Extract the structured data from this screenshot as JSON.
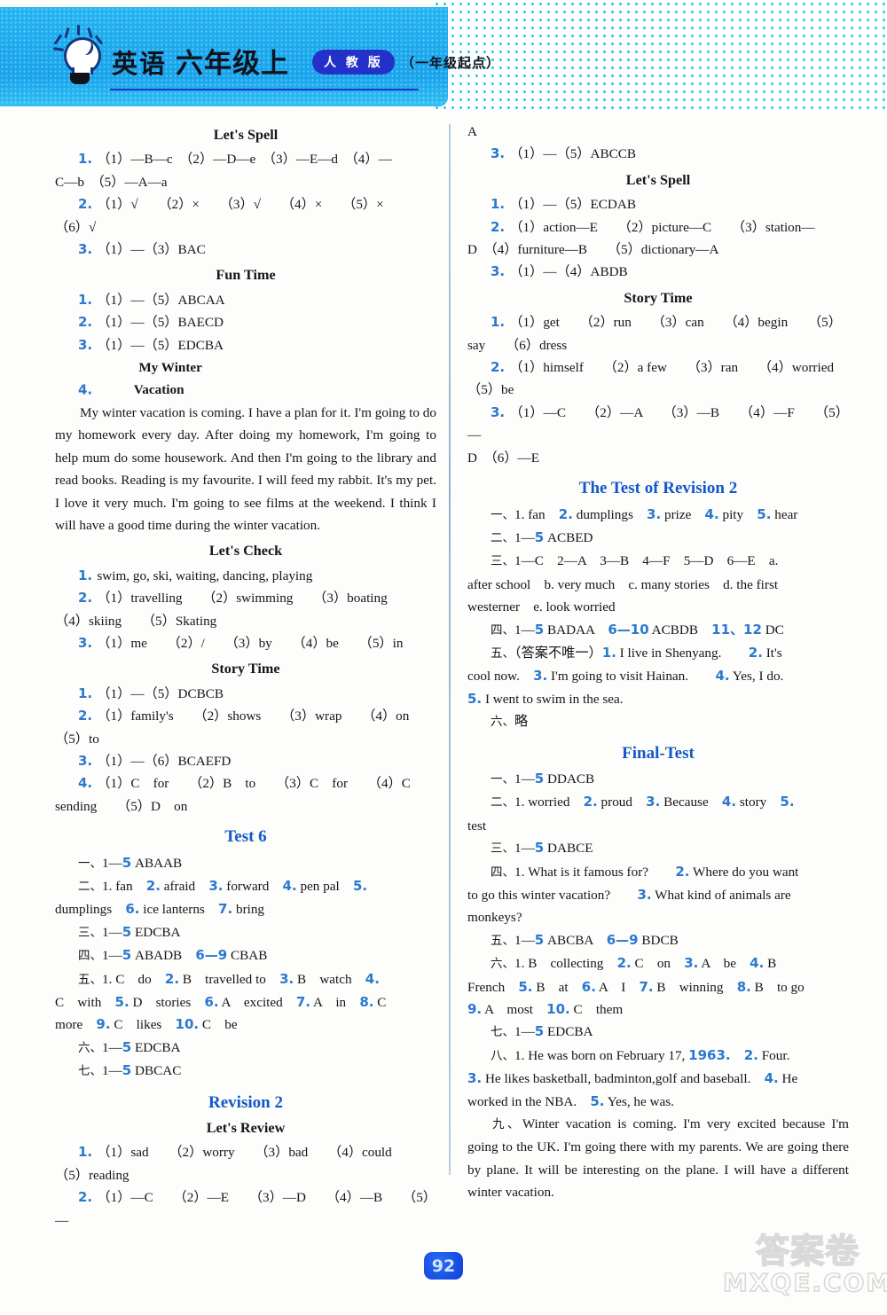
{
  "header": {
    "subject": "英语",
    "grade": "六年级上",
    "edition_pill": "人 教 版",
    "edition_note": "（一年级起点）",
    "bulb_icon": "lightbulb-icon"
  },
  "left_column": {
    "blocks": [
      {
        "type": "section",
        "text": "Let's Spell"
      },
      {
        "type": "line",
        "num": "1.",
        "text": "（1）—B—c　（2）—D—e　（3）—E—d　（4）—"
      },
      {
        "type": "cont",
        "text": "C—b　（5）—A—a"
      },
      {
        "type": "line",
        "num": "2.",
        "text": "（1）√　　（2）×　　（3）√　　（4）×　　（5）×"
      },
      {
        "type": "cont",
        "text": "（6）√"
      },
      {
        "type": "line",
        "num": "3.",
        "text": "（1）—（3）BAC"
      },
      {
        "type": "section",
        "text": "Fun Time"
      },
      {
        "type": "line",
        "num": "1.",
        "text": "（1）—（5）ABCAA"
      },
      {
        "type": "line",
        "num": "2.",
        "text": "（1）—（5）BAECD"
      },
      {
        "type": "line",
        "num": "3.",
        "text": "（1）—（5）EDCBA"
      },
      {
        "type": "line_title",
        "num": "4.",
        "title": "My Winter Vacation"
      },
      {
        "type": "para",
        "text": "My winter vacation is coming. I have a plan for it. I'm going to do my homework every day. After doing my homework, I'm going to help mum do some housework. And then I'm going to the library and read books. Reading is my favourite. I will feed my rabbit. It's my pet. I love it very much. I'm going to see films at the weekend. I think I will have a good time during the winter vacation."
      },
      {
        "type": "section",
        "text": "Let's Check"
      },
      {
        "type": "line",
        "num": "1.",
        "text": "swim, go, ski, waiting, dancing, playing"
      },
      {
        "type": "line",
        "num": "2.",
        "text": "（1）travelling　　（2）swimming　　（3）boating"
      },
      {
        "type": "cont",
        "text": "（4）skiing　　（5）Skating"
      },
      {
        "type": "line",
        "num": "3.",
        "text": "（1）me　　（2）/　　（3）by　　（4）be　　（5）in"
      },
      {
        "type": "section",
        "text": "Story Time"
      },
      {
        "type": "line",
        "num": "1.",
        "text": "（1）—（5）DCBCB"
      },
      {
        "type": "line",
        "num": "2.",
        "text": "（1）family's　　（2）shows　　（3）wrap　　（4）on"
      },
      {
        "type": "cont",
        "text": "（5）to"
      },
      {
        "type": "line",
        "num": "3.",
        "text": "（1）—（6）BCAEFD"
      },
      {
        "type": "line",
        "num": "4.",
        "text": "（1）C　for　　（2）B　to　　（3）C　for　　（4）C"
      },
      {
        "type": "cont",
        "text": "sending　　（5）D　on"
      },
      {
        "type": "bigtitle",
        "text": "Test 6"
      },
      {
        "type": "cnline",
        "cn": "一、",
        "text": "1—5 ABAAB"
      },
      {
        "type": "cnline",
        "cn": "二、",
        "text": "1. fan　2. afraid　3. forward　4. pen pal　5."
      },
      {
        "type": "cont",
        "text": "dumplings　6. ice lanterns　7. bring"
      },
      {
        "type": "cnline",
        "cn": "三、",
        "text": "1—5 EDCBA"
      },
      {
        "type": "cnline",
        "cn": "四、",
        "text": "1—5 ABADB　6—9 CBAB"
      },
      {
        "type": "cnline",
        "cn": "五、",
        "text": "1. C　do　2. B　travelled to　3. B　watch　4."
      },
      {
        "type": "cont",
        "text": "C　with　5. D　stories　6. A　excited　7. A　in　8. C"
      },
      {
        "type": "cont",
        "text": "more　9. C　likes　10. C　be"
      },
      {
        "type": "cnline",
        "cn": "六、",
        "text": "1—5 EDCBA"
      },
      {
        "type": "cnline",
        "cn": "七、",
        "text": "1—5 DBCAC"
      },
      {
        "type": "bigtitle",
        "text": "Revision 2"
      },
      {
        "type": "section",
        "text": "Let's Review"
      },
      {
        "type": "line",
        "num": "1.",
        "text": "（1）sad　　（2）worry　　（3）bad　　（4）could"
      },
      {
        "type": "cont",
        "text": "（5）reading"
      },
      {
        "type": "line",
        "num": "2.",
        "text": "（1）—C　　（2）—E　　（3）—D　　（4）—B　　（5）—"
      }
    ]
  },
  "right_column": {
    "blocks": [
      {
        "type": "cont",
        "text": "A"
      },
      {
        "type": "line",
        "num": "3.",
        "text": "（1）—（5）ABCCB"
      },
      {
        "type": "section",
        "text": "Let's Spell"
      },
      {
        "type": "line",
        "num": "1.",
        "text": "（1）—（5）ECDAB"
      },
      {
        "type": "line",
        "num": "2.",
        "text": "（1）action—E　　（2）picture—C　　（3）station—"
      },
      {
        "type": "cont",
        "text": "D　（4）furniture—B　　（5）dictionary—A"
      },
      {
        "type": "line",
        "num": "3.",
        "text": "（1）—（4）ABDB"
      },
      {
        "type": "section",
        "text": "Story Time"
      },
      {
        "type": "line",
        "num": "1.",
        "text": "（1）get　　（2）run　　（3）can　　（4）begin　　（5）"
      },
      {
        "type": "cont",
        "text": "say　　（6）dress"
      },
      {
        "type": "line",
        "num": "2.",
        "text": "（1）himself　　（2）a few　　（3）ran　　（4）worried"
      },
      {
        "type": "cont",
        "text": "（5）be"
      },
      {
        "type": "line",
        "num": "3.",
        "text": "（1）—C　　（2）—A　　（3）—B　　（4）—F　　（5）—"
      },
      {
        "type": "cont",
        "text": "D　（6）—E"
      },
      {
        "type": "bigtitle",
        "text": "The Test of Revision 2"
      },
      {
        "type": "cnline",
        "cn": "一、",
        "text": "1. fan　2. dumplings　3. prize　4. pity　5. hear"
      },
      {
        "type": "cnline",
        "cn": "二、",
        "text": "1—5 ACBED"
      },
      {
        "type": "cnline",
        "cn": "三、",
        "text": "1—C　2—A　3—B　4—F　5—D　6—E　a."
      },
      {
        "type": "cont",
        "text": "after school　b. very much　c. many stories　d. the first"
      },
      {
        "type": "cont",
        "text": "westerner　e. look worried"
      },
      {
        "type": "cnline",
        "cn": "四、",
        "text": "1—5 BADAA　6—10 ACBDB　11、12 DC"
      },
      {
        "type": "cnline",
        "cn": "五、",
        "text": "（答案不唯一）1. I live in Shenyang.　　2. It's"
      },
      {
        "type": "cont",
        "text": "cool now.　3. I'm going to visit Hainan.　　4. Yes, I do."
      },
      {
        "type": "cont",
        "text": "5. I went to swim in the sea."
      },
      {
        "type": "cnline",
        "cn": "六、",
        "text": "略"
      },
      {
        "type": "bigtitle",
        "text": "Final-Test"
      },
      {
        "type": "cnline",
        "cn": "一、",
        "text": "1—5 DDACB"
      },
      {
        "type": "cnline",
        "cn": "二、",
        "text": "1. worried　2. proud　3. Because　4. story　5."
      },
      {
        "type": "cont",
        "text": "test"
      },
      {
        "type": "cnline",
        "cn": "三、",
        "text": "1—5 DABCE"
      },
      {
        "type": "cnline",
        "cn": "四、",
        "text": "1. What is it famous for?　　2. Where do you want"
      },
      {
        "type": "cont",
        "text": "to go this winter vacation?　　3. What kind of animals are"
      },
      {
        "type": "cont",
        "text": "monkeys?"
      },
      {
        "type": "cnline",
        "cn": "五、",
        "text": "1—5 ABCBA　6—9 BDCB"
      },
      {
        "type": "cnline",
        "cn": "六、",
        "text": "1. B　collecting　2. C　on　3. A　be　4. B"
      },
      {
        "type": "cont",
        "text": "French　5. B　at　6. A　I　7. B　winning　8. B　to go"
      },
      {
        "type": "cont",
        "text": "9. A　most　10. C　them"
      },
      {
        "type": "cnline",
        "cn": "七、",
        "text": "1—5 EDCBA"
      },
      {
        "type": "cnline",
        "cn": "八、",
        "text": "1. He was born on February 17, 1963.　2. Four."
      },
      {
        "type": "cont",
        "text": "3. He likes basketball, badminton,golf and baseball.　4. He"
      },
      {
        "type": "cont",
        "text": "worked in the NBA.　5. Yes, he was."
      },
      {
        "type": "cnpara",
        "cn": "九、",
        "text": "Winter vacation is coming. I'm very excited because I'm going to the UK. I'm going there with my parents. We are going there by plane. It will be interesting on the plane. I will have a different winter vacation."
      }
    ]
  },
  "footer": {
    "page_number": "92",
    "watermark_line1": "答案卷",
    "watermark_line2": "MXQE.COM"
  },
  "colors": {
    "accent_blue": "#2a79cf",
    "heading_blue": "#1358c8",
    "banner_cyan": "#1aa9ee",
    "pill_blue": "#2431c9"
  }
}
